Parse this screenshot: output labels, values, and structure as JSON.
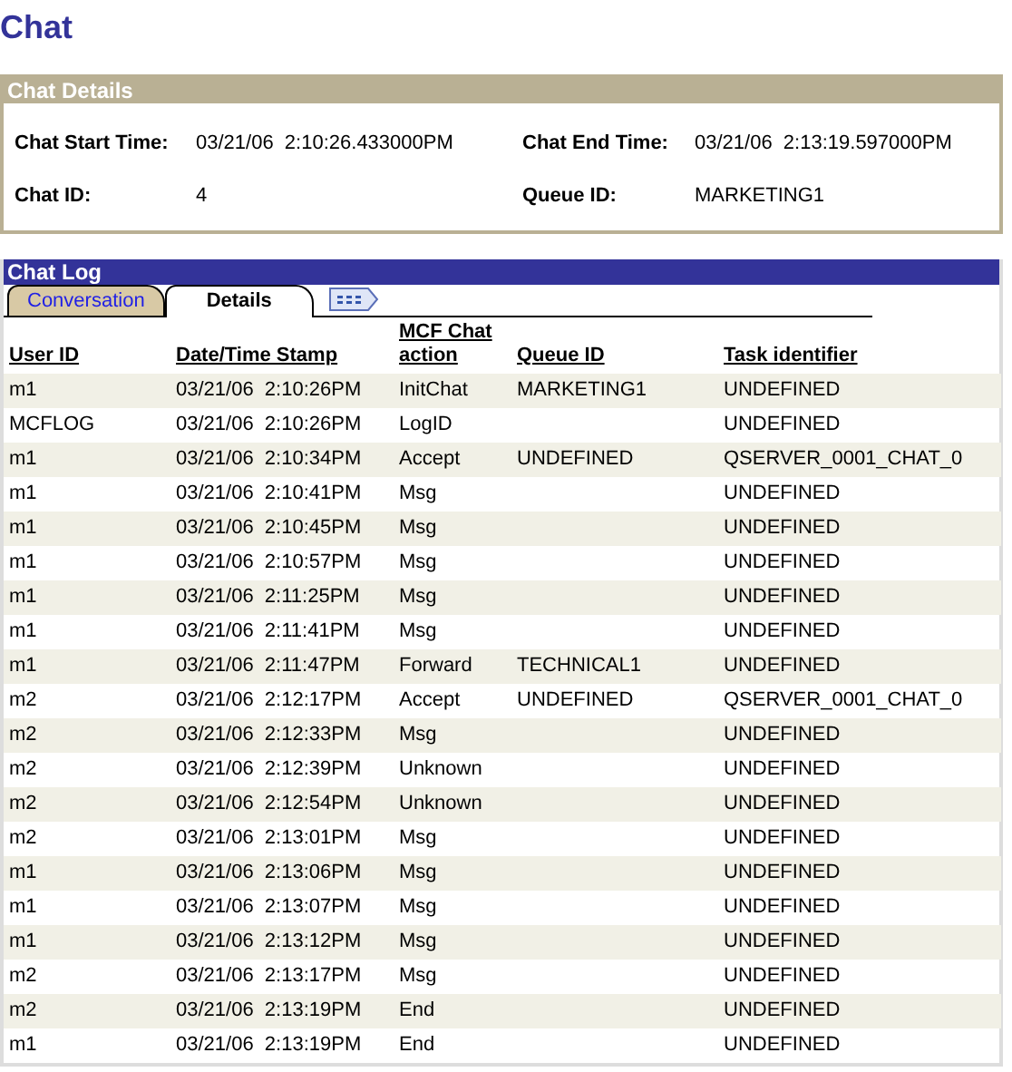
{
  "page_title": "Chat",
  "chat_details": {
    "title": "Chat Details",
    "fields": [
      {
        "label": "Chat Start Time:",
        "value": "03/21/06  2:10:26.433000PM"
      },
      {
        "label": "Chat End Time:",
        "value": "03/21/06  2:13:19.597000PM"
      },
      {
        "label": "Chat ID:",
        "value": "4"
      },
      {
        "label": "Queue ID:",
        "value": "MARKETING1"
      }
    ]
  },
  "chat_log": {
    "title": "Chat Log",
    "tabs": [
      {
        "label": "Conversation",
        "selected": false
      },
      {
        "label": "Details",
        "selected": true
      }
    ],
    "columns": [
      "User ID",
      "Date/Time Stamp",
      "MCF Chat action",
      "Queue ID",
      "Task identifier"
    ],
    "rows": [
      [
        "m1",
        "03/21/06  2:10:26PM",
        "InitChat",
        "MARKETING1",
        "UNDEFINED"
      ],
      [
        "MCFLOG",
        "03/21/06  2:10:26PM",
        "LogID",
        "",
        "UNDEFINED"
      ],
      [
        "m1",
        "03/21/06  2:10:34PM",
        "Accept",
        "UNDEFINED",
        "QSERVER_0001_CHAT_0"
      ],
      [
        "m1",
        "03/21/06  2:10:41PM",
        "Msg",
        "",
        "UNDEFINED"
      ],
      [
        "m1",
        "03/21/06  2:10:45PM",
        "Msg",
        "",
        "UNDEFINED"
      ],
      [
        "m1",
        "03/21/06  2:10:57PM",
        "Msg",
        "",
        "UNDEFINED"
      ],
      [
        "m1",
        "03/21/06  2:11:25PM",
        "Msg",
        "",
        "UNDEFINED"
      ],
      [
        "m1",
        "03/21/06  2:11:41PM",
        "Msg",
        "",
        "UNDEFINED"
      ],
      [
        "m1",
        "03/21/06  2:11:47PM",
        "Forward",
        "TECHNICAL1",
        "UNDEFINED"
      ],
      [
        "m2",
        "03/21/06  2:12:17PM",
        "Accept",
        "UNDEFINED",
        "QSERVER_0001_CHAT_0"
      ],
      [
        "m2",
        "03/21/06  2:12:33PM",
        "Msg",
        "",
        "UNDEFINED"
      ],
      [
        "m2",
        "03/21/06  2:12:39PM",
        "Unknown",
        "",
        "UNDEFINED"
      ],
      [
        "m2",
        "03/21/06  2:12:54PM",
        "Unknown",
        "",
        "UNDEFINED"
      ],
      [
        "m2",
        "03/21/06  2:13:01PM",
        "Msg",
        "",
        "UNDEFINED"
      ],
      [
        "m1",
        "03/21/06  2:13:06PM",
        "Msg",
        "",
        "UNDEFINED"
      ],
      [
        "m1",
        "03/21/06  2:13:07PM",
        "Msg",
        "",
        "UNDEFINED"
      ],
      [
        "m1",
        "03/21/06  2:13:12PM",
        "Msg",
        "",
        "UNDEFINED"
      ],
      [
        "m2",
        "03/21/06  2:13:17PM",
        "Msg",
        "",
        "UNDEFINED"
      ],
      [
        "m2",
        "03/21/06  2:13:19PM",
        "End",
        "",
        "UNDEFINED"
      ],
      [
        "m1",
        "03/21/06  2:13:19PM",
        "End",
        "",
        "UNDEFINED"
      ]
    ]
  }
}
